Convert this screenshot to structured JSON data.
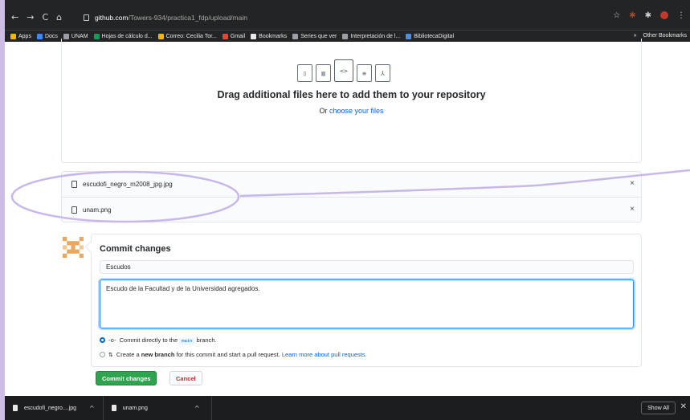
{
  "browser": {
    "nav": {
      "back": "←",
      "forward": "→",
      "reload": "C",
      "home": "⌂"
    },
    "url_host": "github.com",
    "url_path": "/Towers-934/practica1_fdp/upload/main",
    "toolbar_icons": {
      "star": "☆",
      "extensions": "✱",
      "menu": "⋮"
    },
    "bookmarks": [
      {
        "label": "Apps",
        "color": "#f4b400"
      },
      {
        "label": "Docs",
        "color": "#4285f4"
      },
      {
        "label": "UNAM",
        "color": "#9aa0a6"
      },
      {
        "label": "Hojas de cálculo d...",
        "color": "#0f9d58"
      },
      {
        "label": "Correo: Cecilia Tor...",
        "color": "#f4b400"
      },
      {
        "label": "Gmail",
        "color": "#ea4335"
      },
      {
        "label": "Bookmarks",
        "color": "#e8e8e8"
      },
      {
        "label": "Series que ver",
        "color": "#9aa0a6"
      },
      {
        "label": "Interpretación de l...",
        "color": "#9aa0a6"
      },
      {
        "label": "BibliotecaDigital",
        "color": "#4a90e2"
      }
    ],
    "bookmarks_more": "»",
    "other_bookmarks": "Other Bookmarks"
  },
  "dropzone": {
    "icons": [
      "zip",
      "chart",
      "code",
      "doc",
      "pdf"
    ],
    "title": "Drag additional files here to add them to your repository",
    "or_text": "Or ",
    "choose_link": "choose your files"
  },
  "files": [
    {
      "name": "escudofi_negro_m2008_jpg.jpg",
      "remove": "×"
    },
    {
      "name": "unam.png",
      "remove": "×"
    }
  ],
  "commit": {
    "title": "Commit changes",
    "summary_value": "Escudos",
    "description_value": "Escudo de la Facultad y de la Universidad agregados.",
    "option_direct_pre": "Commit directly to the ",
    "option_direct_branch": "main",
    "option_direct_post": " branch.",
    "option_new_pre": "Create a ",
    "option_new_bold": "new branch",
    "option_new_post": " for this commit and start a pull request. ",
    "option_new_link": "Learn more about pull requests.",
    "commit_button": "Commit changes",
    "cancel_button": "Cancel"
  },
  "colors": {
    "accent": "#0366d6",
    "commit_green": "#2ea44f",
    "cancel_red": "#cb2431",
    "annotation": "#c8b8ea"
  },
  "downloads": {
    "items": [
      {
        "label": "escudofi_negro....jpg",
        "caret": "^"
      },
      {
        "label": "unam.png",
        "caret": "^"
      }
    ],
    "show_all": "Show All",
    "close": "✕"
  }
}
